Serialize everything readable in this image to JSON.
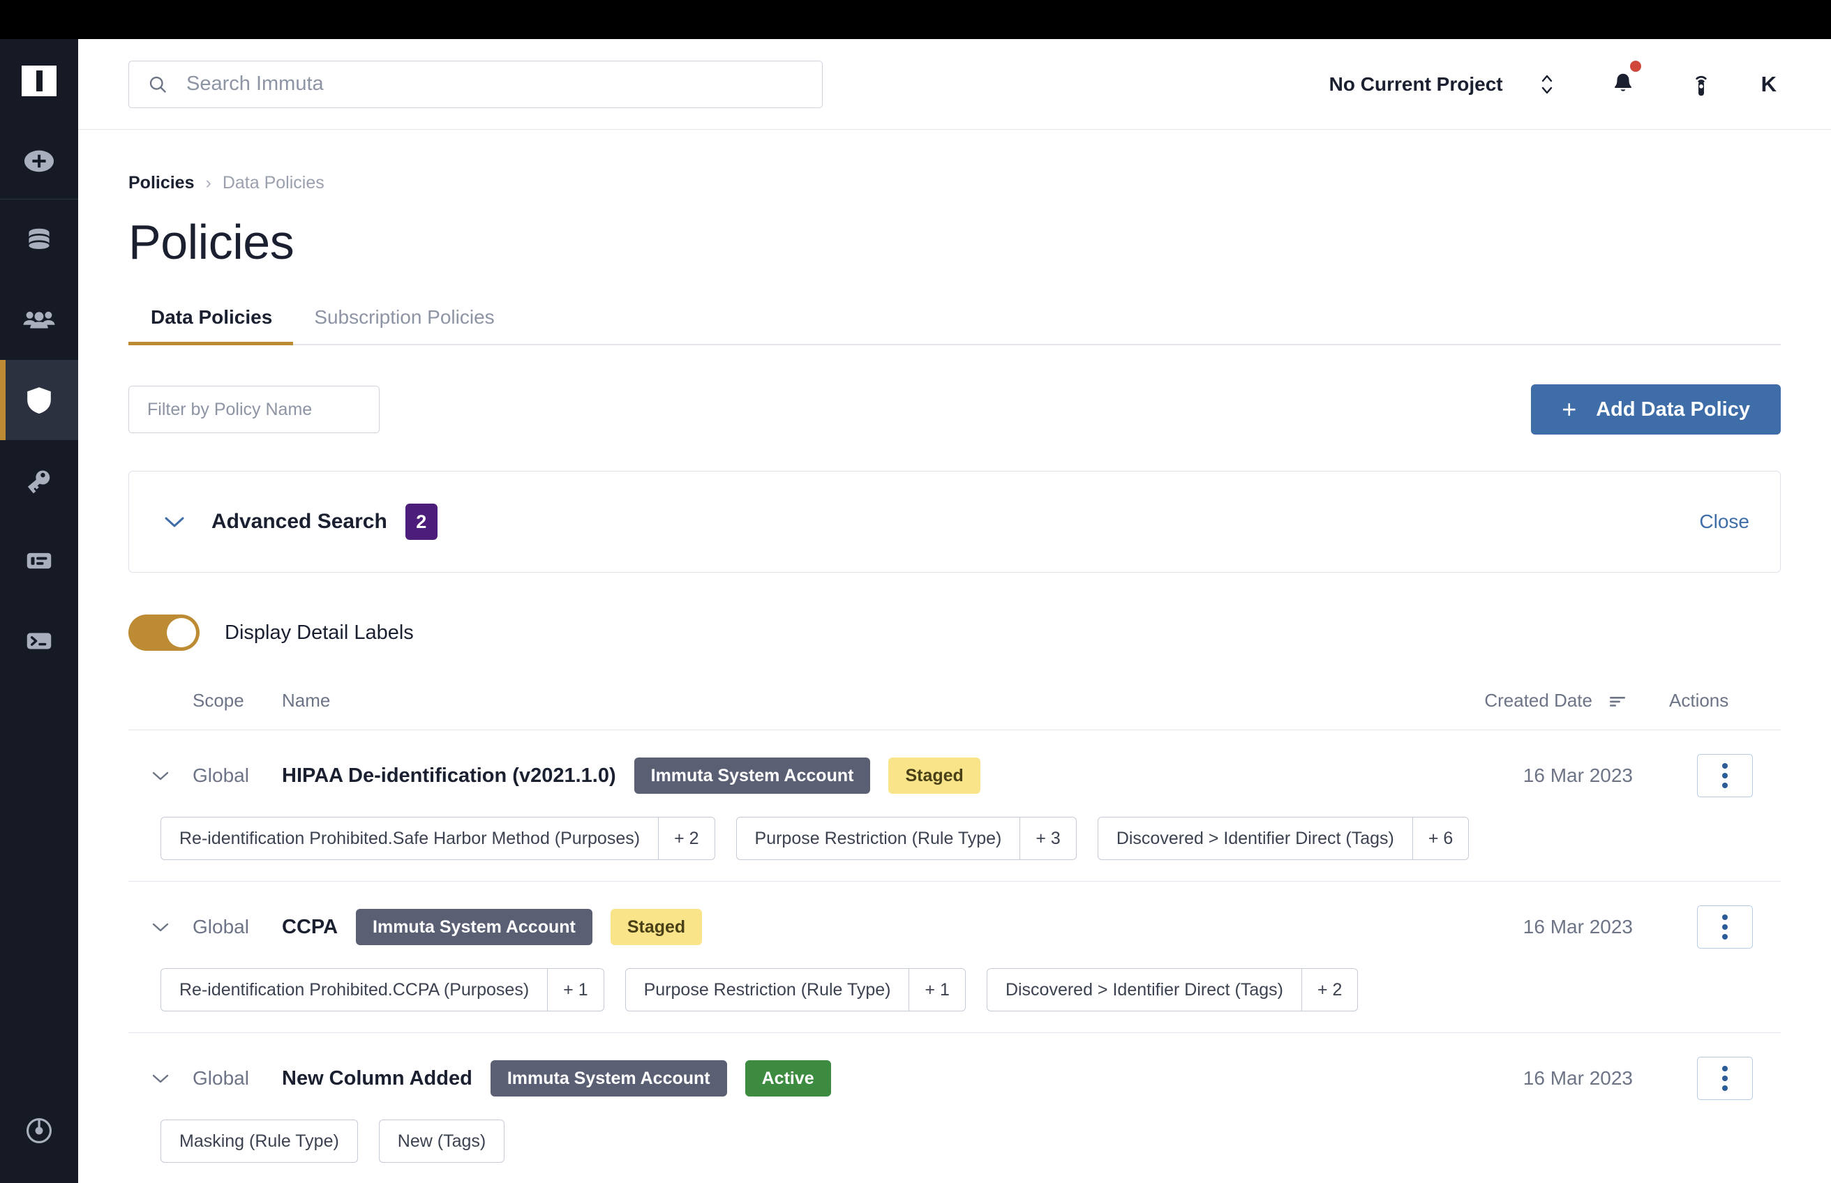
{
  "sidebar": {
    "logo_icon": "immuta-logo-icon",
    "items": [
      {
        "icon": "plus-circle-icon",
        "name": "add-button"
      },
      {
        "icon": "database-icon",
        "name": "sidebar-item-data-sources"
      },
      {
        "icon": "people-icon",
        "name": "sidebar-item-people"
      },
      {
        "icon": "shield-icon",
        "name": "sidebar-item-policies",
        "active": true
      },
      {
        "icon": "key-icon",
        "name": "sidebar-item-identity"
      },
      {
        "icon": "report-icon",
        "name": "sidebar-item-reports"
      },
      {
        "icon": "terminal-icon",
        "name": "sidebar-item-query"
      }
    ],
    "bottom": {
      "icon": "power-icon",
      "name": "sidebar-item-logout"
    }
  },
  "header": {
    "search_placeholder": "Search Immuta",
    "search_value": "",
    "search_icon": "search-icon",
    "project_label": "No Current Project",
    "project_switch_icon": "chevron-up-down-icon",
    "notifications_icon": "bell-icon",
    "notifications_has_unread": true,
    "beacon_icon": "beacon-icon",
    "avatar_initial": "K"
  },
  "breadcrumb": {
    "root": "Policies",
    "separator": "›",
    "current": "Data Policies"
  },
  "page": {
    "title": "Policies"
  },
  "tabs": [
    {
      "label": "Data Policies",
      "active": true
    },
    {
      "label": "Subscription Policies",
      "active": false
    }
  ],
  "filter": {
    "placeholder": "Filter by Policy Name",
    "value": ""
  },
  "add_policy": {
    "label": "Add Data Policy",
    "plus": "+",
    "color": "#3f6da8"
  },
  "advanced_search": {
    "chevron_icon": "chevron-down-icon",
    "title": "Advanced Search",
    "badge_count": "2",
    "badge_color": "#4c1d7a",
    "close_label": "Close",
    "close_color": "#3f6da8"
  },
  "display_detail_labels": {
    "label": "Display Detail Labels",
    "enabled": true,
    "color": "#bd8b33"
  },
  "table": {
    "headers": {
      "scope": "Scope",
      "name": "Name",
      "created_date": "Created Date",
      "sort_icon": "sort-descending-icon",
      "actions": "Actions"
    },
    "rows": [
      {
        "chevron_icon": "chevron-down-icon",
        "scope": "Global",
        "name": "HIPAA De-identification (v2021.1.0)",
        "owner_pill": "Immuta System Account",
        "status_pill": "Staged",
        "status_kind": "staged",
        "created_date": "16 Mar 2023",
        "actions_icon": "kebab-menu-icon",
        "chips": [
          {
            "label": "Re-identification Prohibited.Safe Harbor Method (Purposes)",
            "count": "+ 2"
          },
          {
            "label": "Purpose Restriction (Rule Type)",
            "count": "+ 3"
          },
          {
            "label": "Discovered > Identifier Direct (Tags)",
            "count": "+ 6"
          }
        ]
      },
      {
        "chevron_icon": "chevron-down-icon",
        "scope": "Global",
        "name": "CCPA",
        "owner_pill": "Immuta System Account",
        "status_pill": "Staged",
        "status_kind": "staged",
        "created_date": "16 Mar 2023",
        "actions_icon": "kebab-menu-icon",
        "chips": [
          {
            "label": "Re-identification Prohibited.CCPA (Purposes)",
            "count": "+ 1"
          },
          {
            "label": "Purpose Restriction (Rule Type)",
            "count": "+ 1"
          },
          {
            "label": "Discovered > Identifier Direct (Tags)",
            "count": "+ 2"
          }
        ]
      },
      {
        "chevron_icon": "chevron-down-icon",
        "scope": "Global",
        "name": "New Column Added",
        "owner_pill": "Immuta System Account",
        "status_pill": "Active",
        "status_kind": "active",
        "created_date": "16 Mar 2023",
        "actions_icon": "kebab-menu-icon",
        "chips": [
          {
            "label": "Masking (Rule Type)",
            "count": ""
          },
          {
            "label": "New (Tags)",
            "count": ""
          }
        ]
      }
    ]
  }
}
